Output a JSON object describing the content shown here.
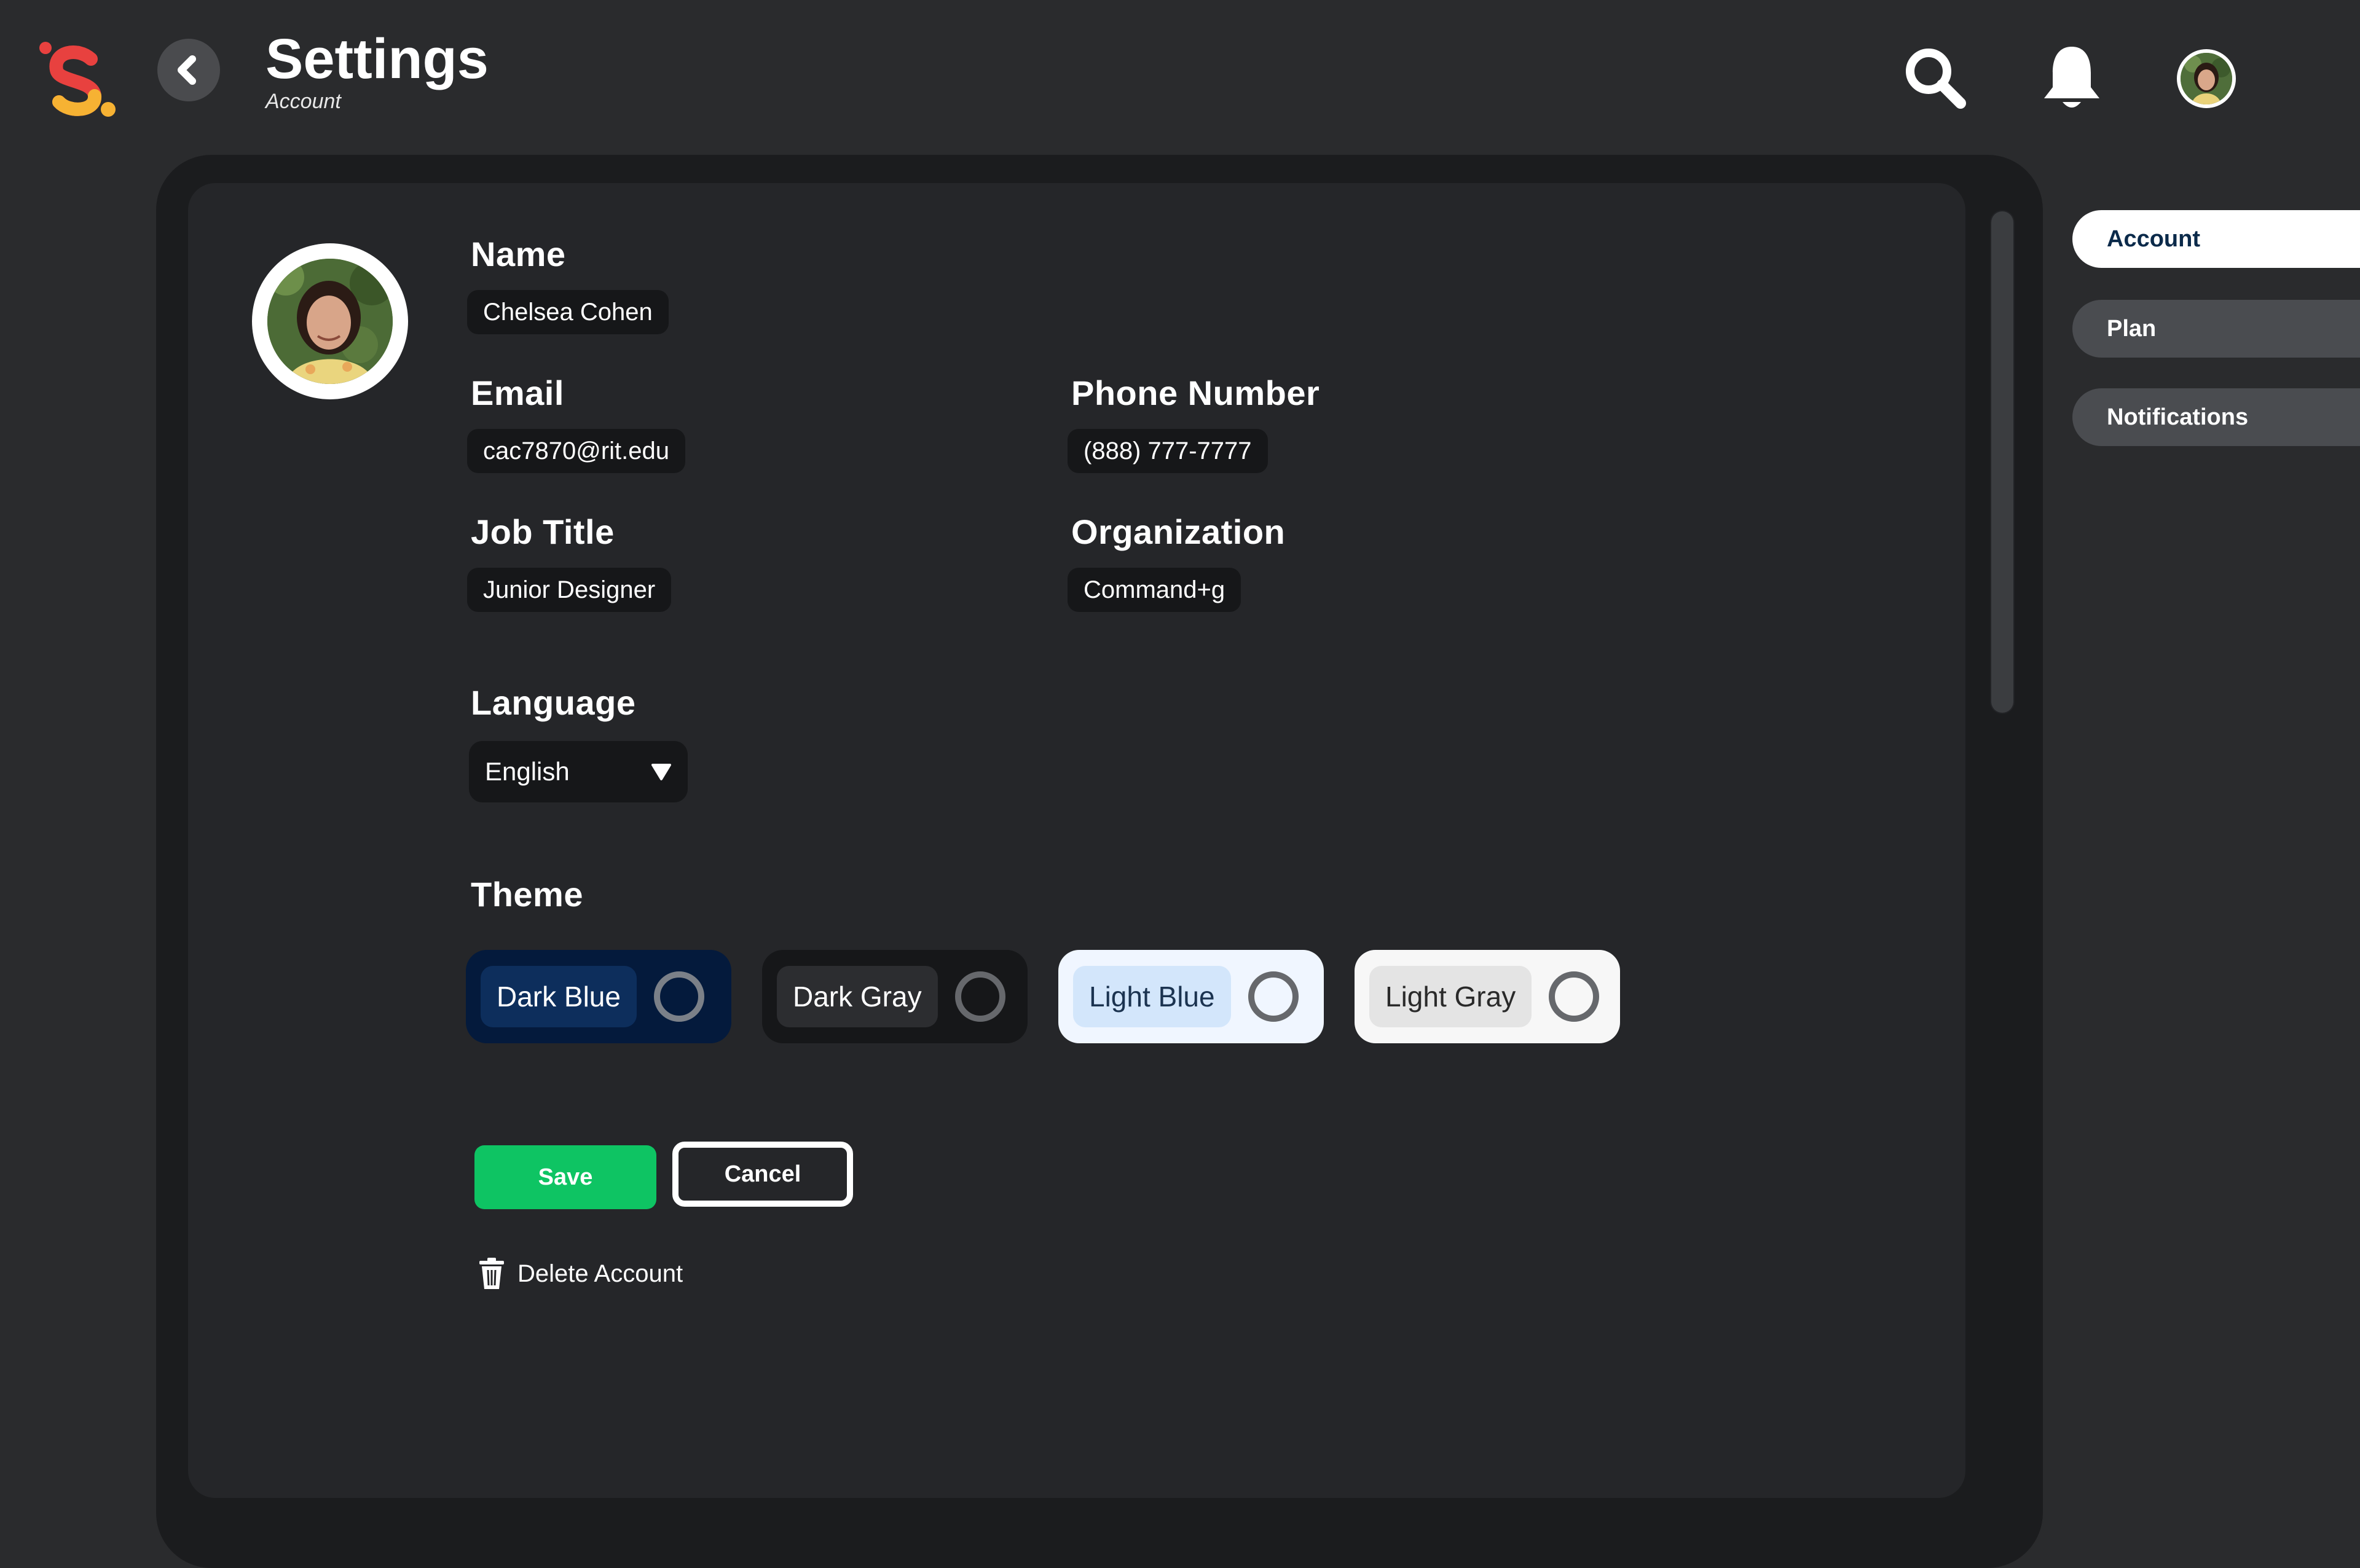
{
  "header": {
    "title": "Settings",
    "subtitle": "Account",
    "logo_letter": "S"
  },
  "profile": {
    "fields": {
      "name": {
        "label": "Name",
        "value": "Chelsea Cohen"
      },
      "email": {
        "label": "Email",
        "value": "cac7870@rit.edu"
      },
      "phone": {
        "label": "Phone Number",
        "value": "(888) 777-7777"
      },
      "job_title": {
        "label": "Job Title",
        "value": "Junior Designer"
      },
      "organization": {
        "label": "Organization",
        "value": "Command+g"
      }
    },
    "language": {
      "label": "Language",
      "value": "English"
    },
    "theme": {
      "label": "Theme",
      "options": [
        {
          "label": "Dark Blue",
          "bg": "#041a3c",
          "chip": "#0d2e5c",
          "text": "#ffffff",
          "ring": "#7b8088",
          "selected": false
        },
        {
          "label": "Dark Gray",
          "bg": "#161719",
          "chip": "#2c2d30",
          "text": "#ffffff",
          "ring": "#66686c",
          "selected": false
        },
        {
          "label": "Light Blue",
          "bg": "#f0f6ff",
          "chip": "#d3e6fb",
          "text": "#1b3350",
          "ring": "#66686c",
          "selected": false
        },
        {
          "label": "Light Gray",
          "bg": "#f7f7f7",
          "chip": "#e4e4e4",
          "text": "#2a2a2a",
          "ring": "#66686c",
          "selected": false
        }
      ]
    }
  },
  "actions": {
    "save_label": "Save",
    "cancel_label": "Cancel",
    "delete_label": "Delete Account"
  },
  "side_tabs": [
    {
      "label": "Account",
      "active": true
    },
    {
      "label": "Plan",
      "active": false
    },
    {
      "label": "Notifications",
      "active": false
    }
  ],
  "colors": {
    "background": "#2a2b2d",
    "frame": "#1b1c1e",
    "card": "#252629",
    "save_green": "#0ec463",
    "logo_red": "#e8413f",
    "logo_yellow": "#f6b233"
  },
  "icons": [
    "logo-icon",
    "back-arrow-icon",
    "search-icon",
    "bell-icon",
    "avatar",
    "dropdown-caret-icon",
    "trash-icon"
  ]
}
